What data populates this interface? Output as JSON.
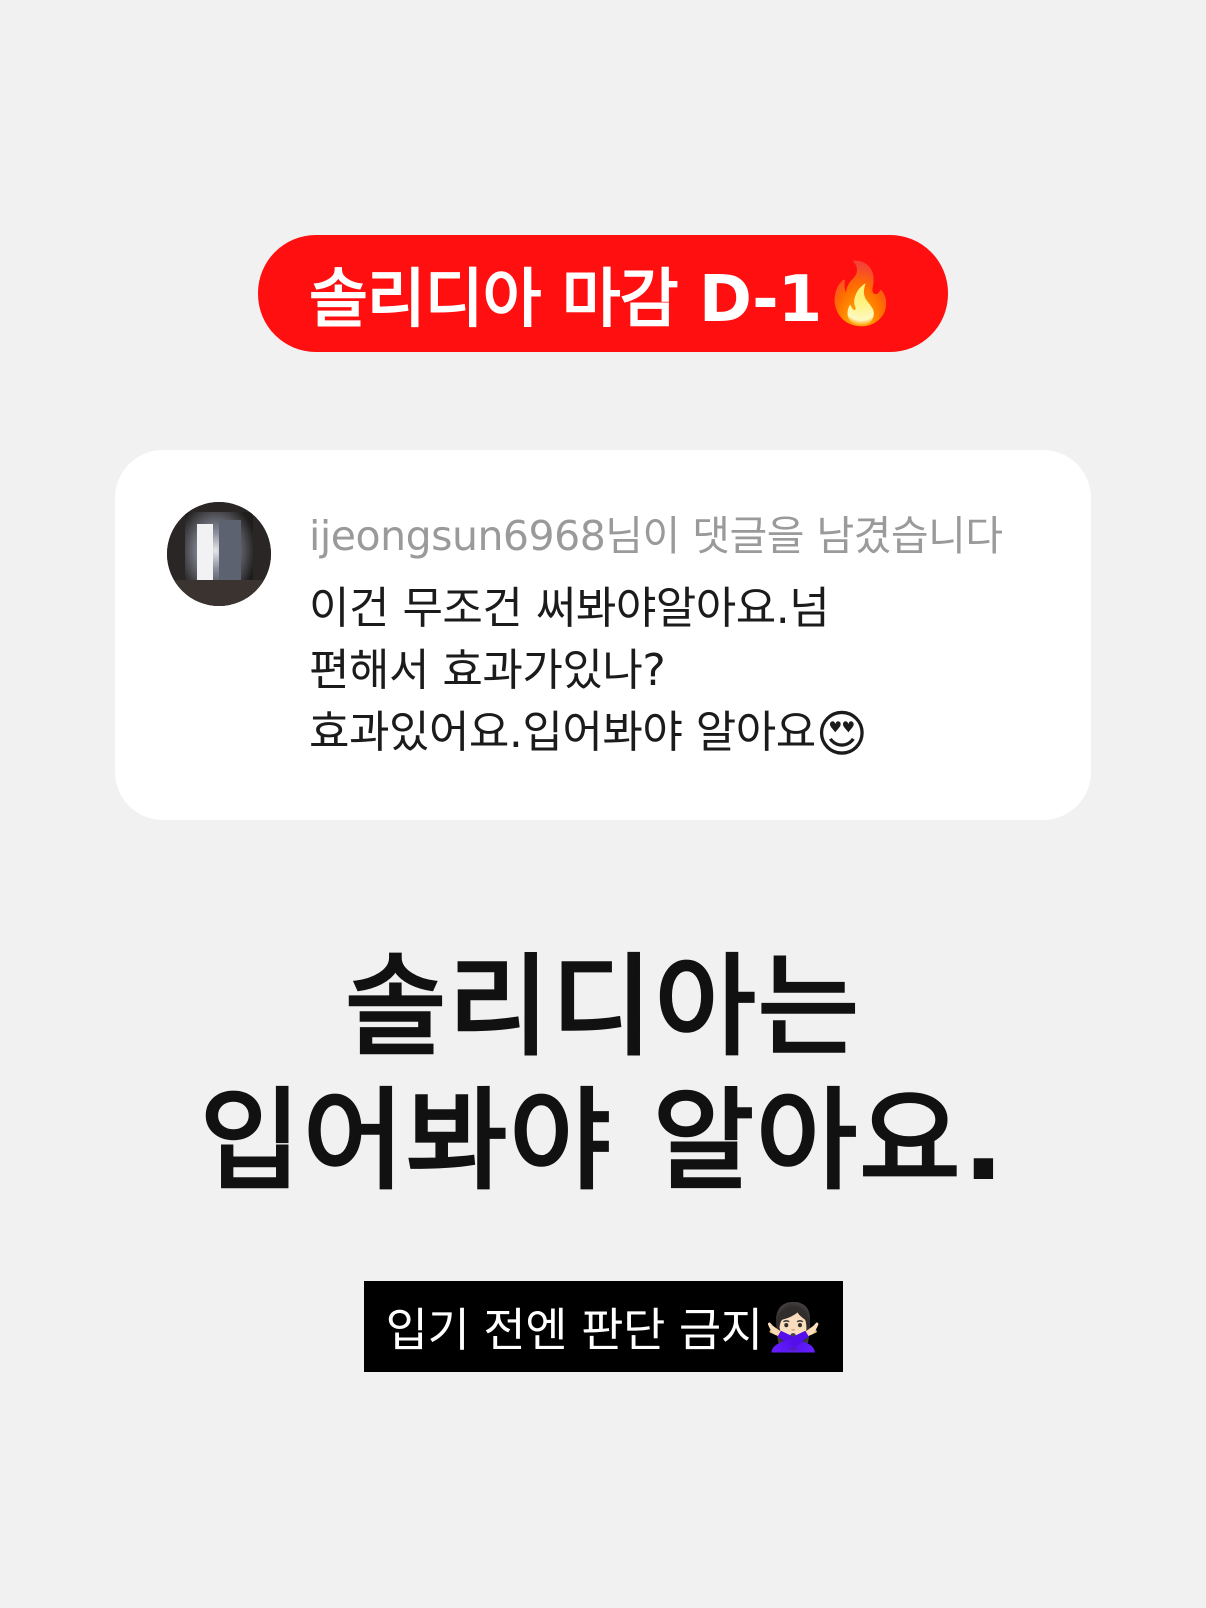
{
  "banner": {
    "text": "솔리디아 마감 D-1",
    "emoji": "🔥",
    "background": "#ff0f0f"
  },
  "comment": {
    "notice": "ijeongsun6968님이 댓글을 남겼습니다",
    "lines": [
      "이건 무조건 써봐야알아요.넘",
      "편해서 효과가있나?",
      "효과있어요.입어봐야 알아요"
    ],
    "emoji": "😍"
  },
  "headline": {
    "line1": "솔리디아는",
    "line2": "입어봐야  알아요."
  },
  "caption": {
    "text": "입기 전엔 판단 금지",
    "emoji": "🙅🏻‍♀️"
  }
}
